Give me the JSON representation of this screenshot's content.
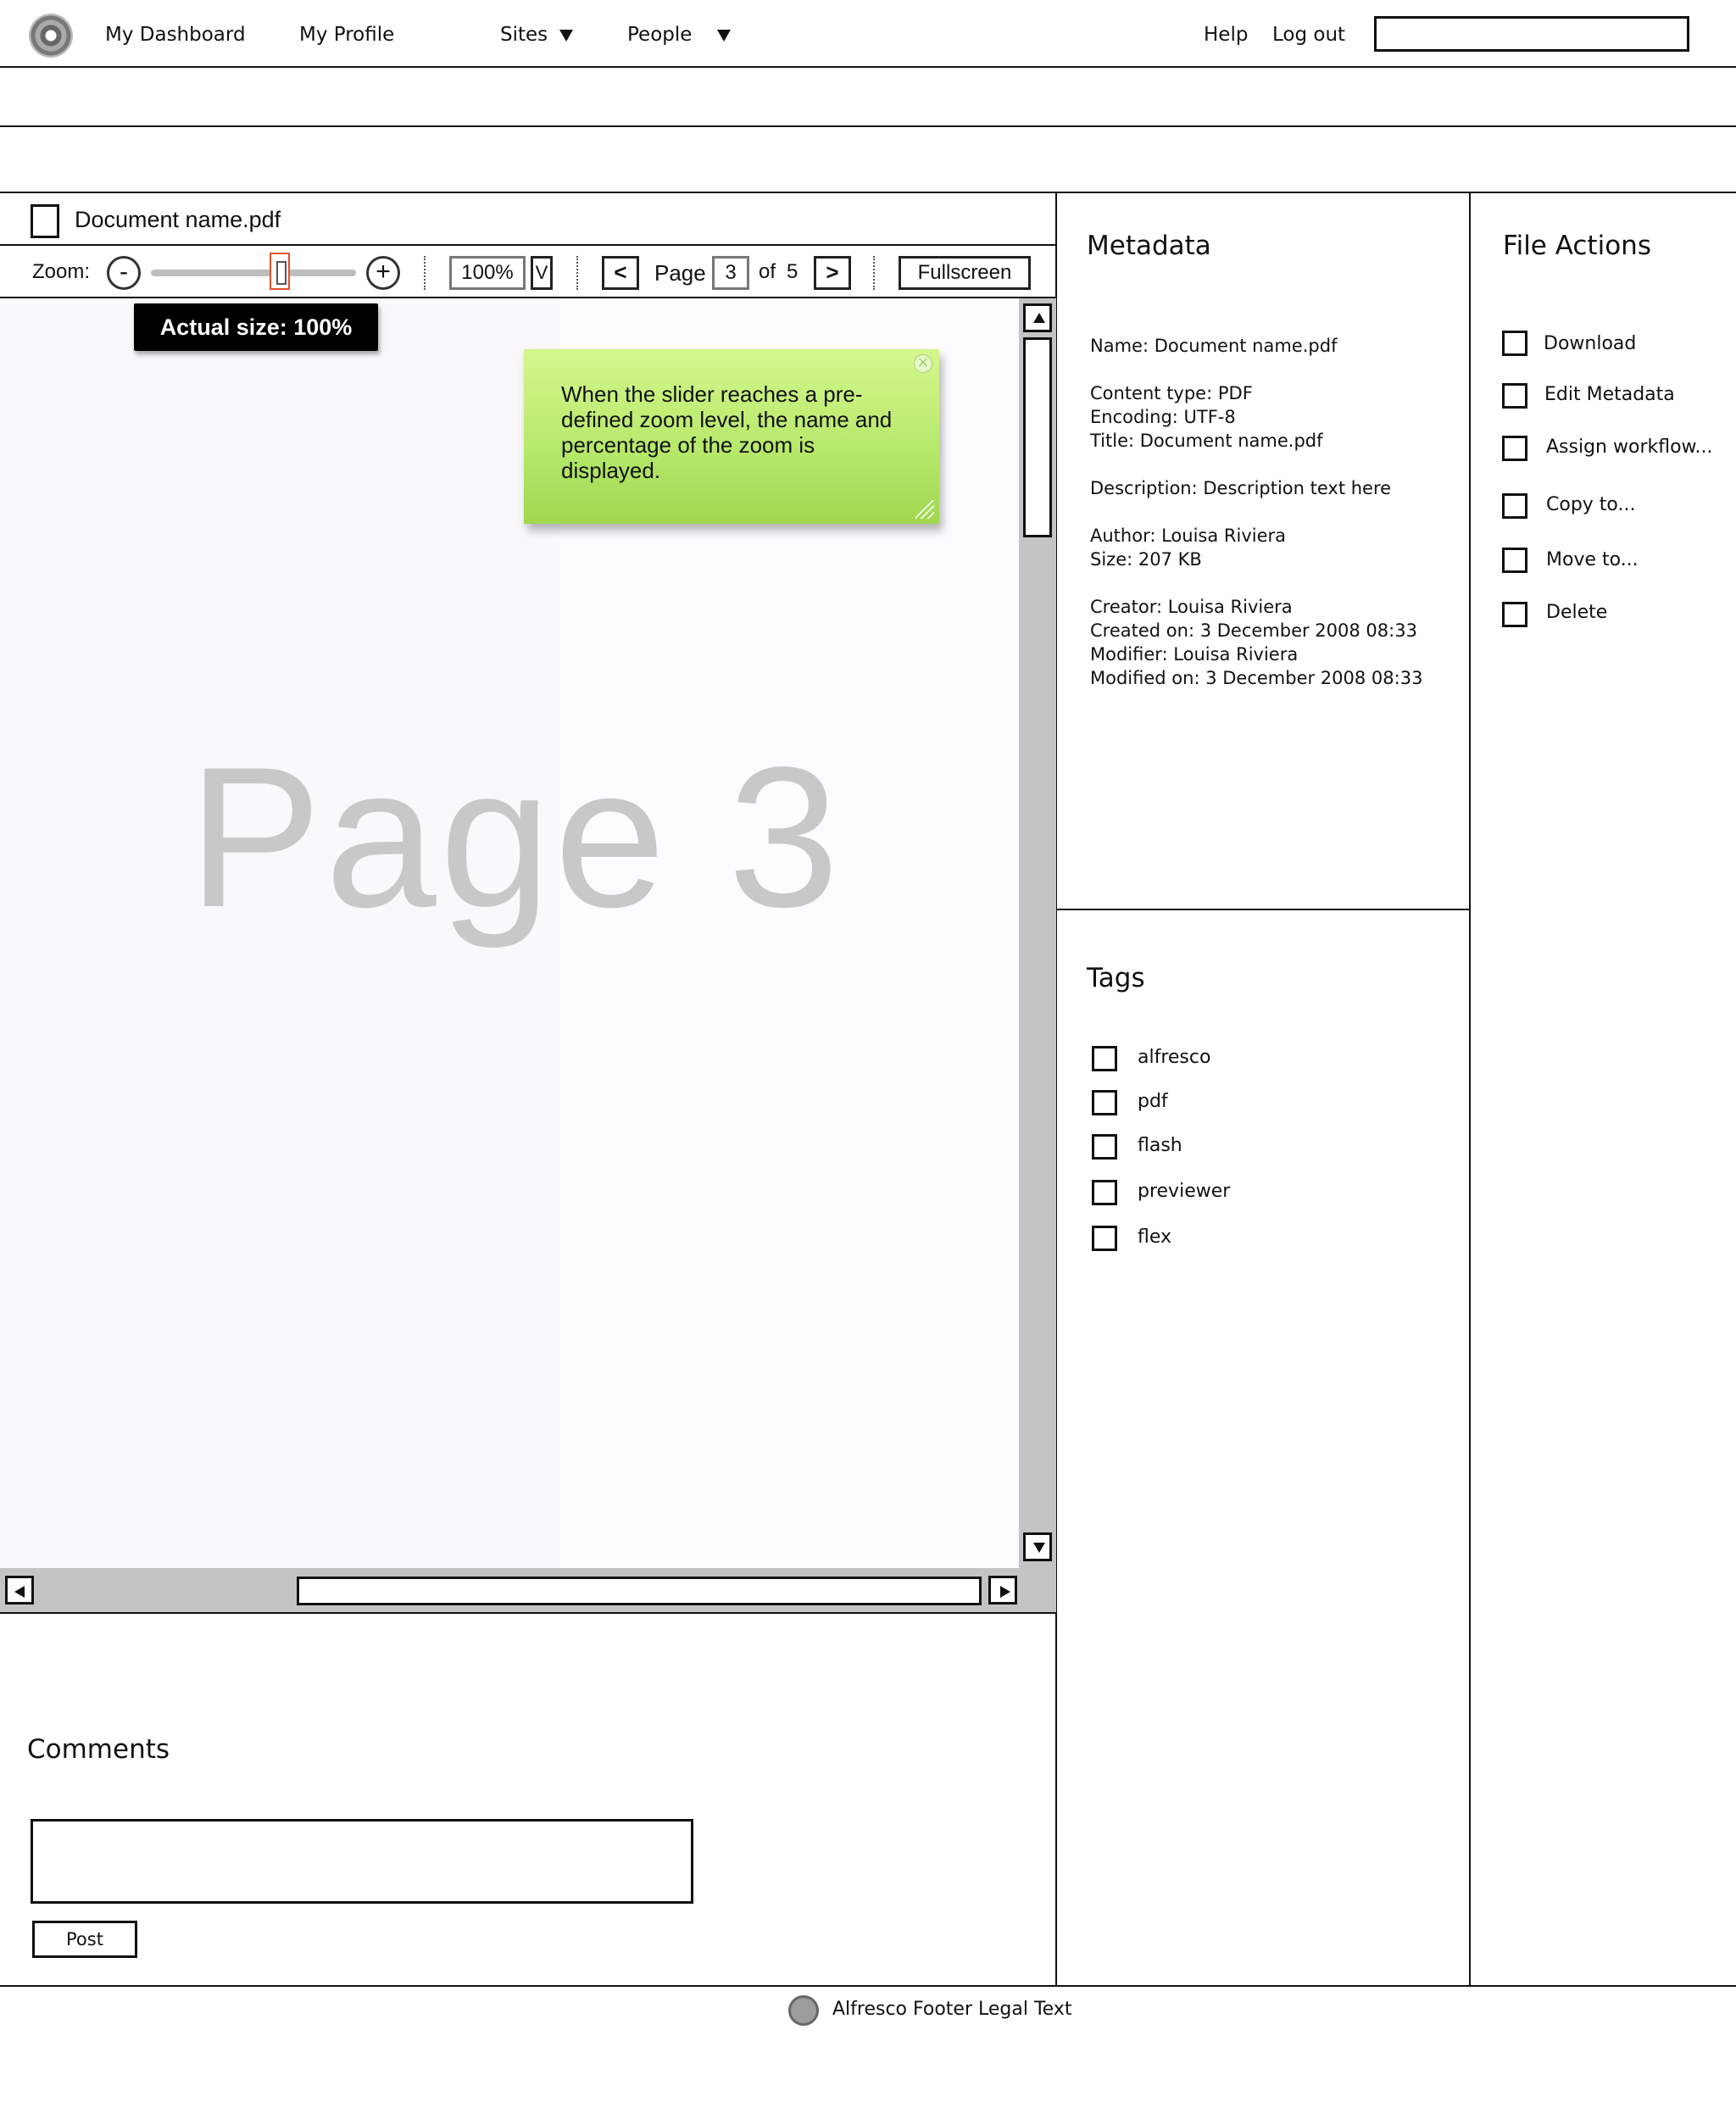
{
  "nav": {
    "dashboard": "My Dashboard",
    "profile": "My Profile",
    "sites": "Sites",
    "people": "People",
    "help": "Help",
    "logout": "Log out",
    "search_value": ""
  },
  "document": {
    "name": "Document  name.pdf"
  },
  "toolbar": {
    "zoom_label": "Zoom:",
    "zoom_out": "-",
    "zoom_in": "+",
    "zoom_value": "100%",
    "zoom_dropdown": "V",
    "prev": "<",
    "page_label": "Page",
    "page_value": "3",
    "of_label": "of",
    "page_total": "5",
    "next": ">",
    "fullscreen": "Fullscreen"
  },
  "viewer": {
    "tooltip": "Actual size: 100%",
    "page_text": "Page 3",
    "note": "When the slider reaches a pre-defined zoom level, the name and percentage of the zoom is displayed.",
    "note_close": "×"
  },
  "comments": {
    "title": "Comments",
    "input_value": "",
    "post": "Post"
  },
  "metadata": {
    "title": "Metadata",
    "lines": [
      "Name:  Document name.pdf",
      "Content type:  PDF",
      "Encoding: UTF-8",
      "Title: Document name.pdf",
      "Description: Description text here",
      "Author:  Louisa Riviera",
      "Size: 207 KB",
      "Creator: Louisa Riviera",
      "Created on: 3 December 2008 08:33",
      "Modifier: Louisa Riviera",
      "Modified on:  3 December 2008 08:33"
    ]
  },
  "tags": {
    "title": "Tags",
    "items": [
      "alfresco",
      "pdf",
      "flash",
      "previewer",
      "flex"
    ]
  },
  "actions": {
    "title": "File Actions",
    "items": [
      "Download",
      "Edit Metadata",
      "Assign workflow...",
      "Copy to...",
      "Move to...",
      "Delete"
    ]
  },
  "footer": {
    "text": "Alfresco Footer Legal Text"
  }
}
